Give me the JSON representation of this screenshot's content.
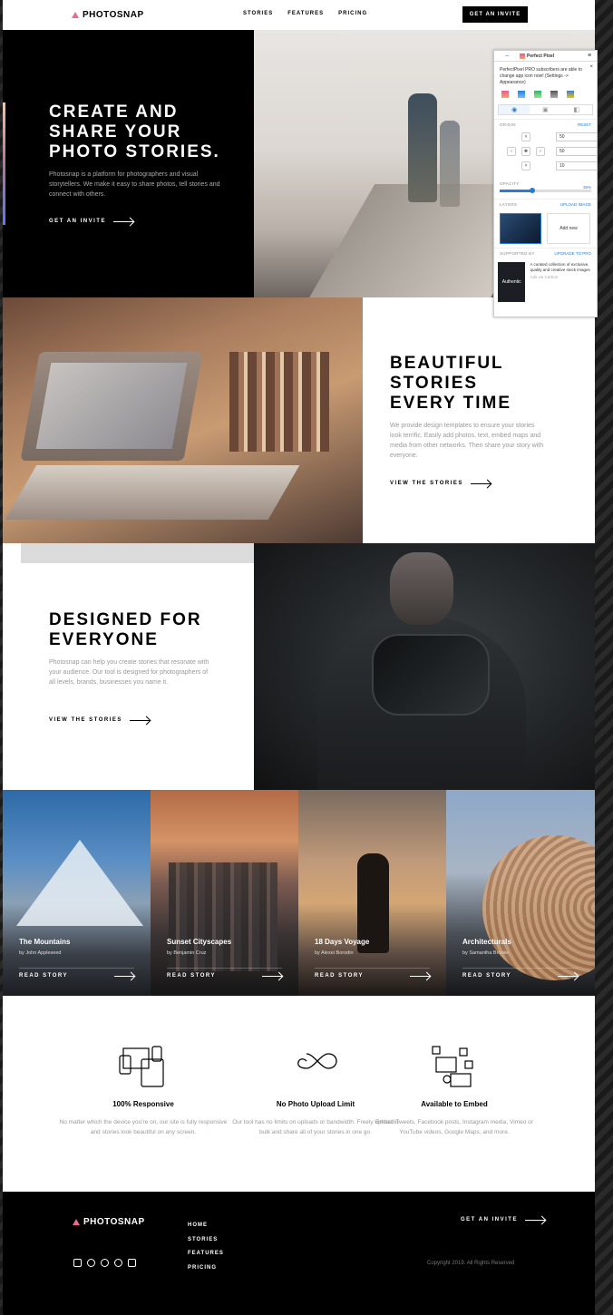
{
  "brand": "PHOTOSNAP",
  "header": {
    "nav": [
      "STORIES",
      "FEATURES",
      "PRICING"
    ],
    "cta": "GET AN INVITE"
  },
  "hero": {
    "title": "CREATE AND SHARE YOUR PHOTO STORIES.",
    "text": "Photosnap is a platform for photographers and visual storytellers. We make it easy to share photos, tell stories and connect with others.",
    "cta": "GET AN INVITE"
  },
  "section2": {
    "title": "BEAUTIFUL STORIES EVERY TIME",
    "text": "We provide design templates to ensure your stories look terrific. Easily add photos, text, embed maps and media from other networks. Then share your story with everyone.",
    "cta": "VIEW THE STORIES"
  },
  "section3": {
    "title": "DESIGNED FOR EVERYONE",
    "text": "Photosnap can help you create stories that resonate with your audience. Our tool is designed for photographers of all levels, brands, businesses you name it.",
    "cta": "VIEW THE STORIES"
  },
  "stories": [
    {
      "title": "The Mountains",
      "author": "by John Appleseed",
      "cta": "READ STORY"
    },
    {
      "title": "Sunset Cityscapes",
      "author": "by Benjamin Cruz",
      "cta": "READ STORY"
    },
    {
      "title": "18 Days Voyage",
      "author": "by Alexei Borodin",
      "cta": "READ STORY"
    },
    {
      "title": "Architecturals",
      "author": "by Samantha Brooke",
      "cta": "READ STORY"
    }
  ],
  "features": [
    {
      "icon": "responsive-devices-icon",
      "title": "100% Responsive",
      "text": "No matter which the device you're on, our site is fully responsive and stories look beautiful on any screen."
    },
    {
      "icon": "infinity-icon",
      "title": "No Photo Upload Limit",
      "text": "Our tool has no limits on uploads or bandwidth. Freely upload in bulk and share all of your stories in one go."
    },
    {
      "icon": "embed-icon",
      "title": "Available to Embed",
      "text": "Embed Tweets, Facebook posts, Instagram media, Vimeo or YouTube videos, Google Maps, and more."
    }
  ],
  "footer": {
    "nav": [
      "HOME",
      "STORIES",
      "FEATURES",
      "PRICING"
    ],
    "cta": "GET AN INVITE",
    "copyright": "Copyright 2019. All Rights Reserved",
    "social": [
      "facebook-icon",
      "youtube-icon",
      "twitter-icon",
      "pinterest-icon",
      "instagram-icon"
    ]
  },
  "perfect_pixel": {
    "title": "Perfect Pixel",
    "minimize": "–",
    "note": "PerfectPixel PRO subscribers are able to change app icon now! (Settings -> Appearance)",
    "origin_label": "ORIGIN",
    "reset": "RESET",
    "x": "50",
    "y": "50",
    "z": "10",
    "opacity_label": "OPACITY",
    "opacity_value": "35%",
    "layers_label": "LAYERS",
    "upload": "UPLOAD IMAGE",
    "add_new": "Add new",
    "supported_by": "SUPPORTED BY",
    "upgrade": "UPGRADE TO PRO",
    "ad_brand": "Authentic",
    "ad_text": "A curated collection of exclusive, quality and creative stock images",
    "ad_sub": "Ads via Carbon"
  },
  "colors": {
    "accent_gradient": [
      "#ffc593",
      "#bc7198",
      "#5a77ff"
    ],
    "dark": "#000000",
    "muted_text": "#999999"
  }
}
